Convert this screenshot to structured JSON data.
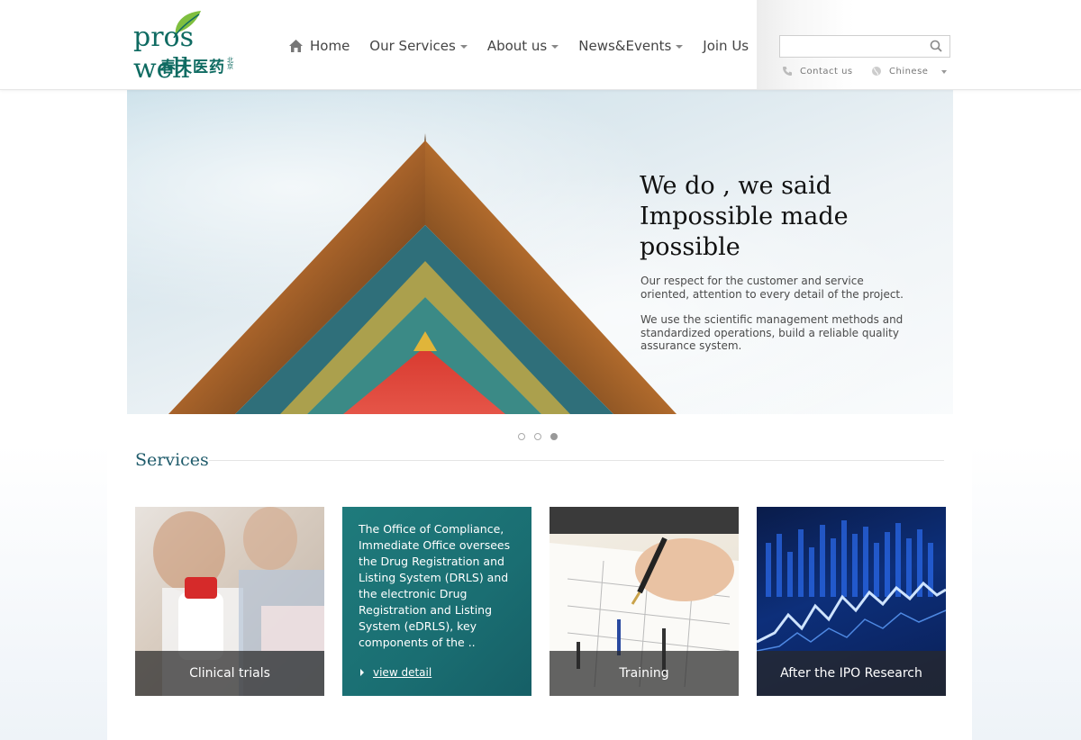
{
  "logo": {
    "word": "pros well",
    "chinese": "春天医药",
    "chinese_small": "北京"
  },
  "nav": {
    "items": [
      {
        "label": "Home",
        "icon": "home-icon"
      },
      {
        "label": "Our Services",
        "dropdown": true
      },
      {
        "label": "About us",
        "dropdown": true
      },
      {
        "label": "News&Events",
        "dropdown": true
      },
      {
        "label": "Join Us"
      }
    ]
  },
  "search": {
    "value": "",
    "placeholder": ""
  },
  "utility": {
    "contact": "Contact us",
    "language": "Chinese"
  },
  "banner": {
    "headline": "We do , we said Impossible made possible",
    "paragraph1": "Our respect for the customer and service oriented, attention to every detail of the project.",
    "paragraph2": "We use the scientific management methods and standardized operations, build a reliable quality assurance system.",
    "active_slide": 3,
    "slide_count": 3
  },
  "services": {
    "title": "Services",
    "cards": [
      {
        "caption": "Clinical trials"
      },
      {
        "description": "The Office of Compliance, Immediate Office oversees the Drug Registration and Listing System (DRLS) and the electronic Drug Registration and Listing System (eDRLS), key components of the ..",
        "link": "view detail"
      },
      {
        "caption": "Training"
      },
      {
        "caption": "After the IPO Research"
      }
    ]
  },
  "colors": {
    "brand_green": "#0f6b62",
    "teal_card": "#1a6e72",
    "heading_blue": "#1f5b6b"
  }
}
